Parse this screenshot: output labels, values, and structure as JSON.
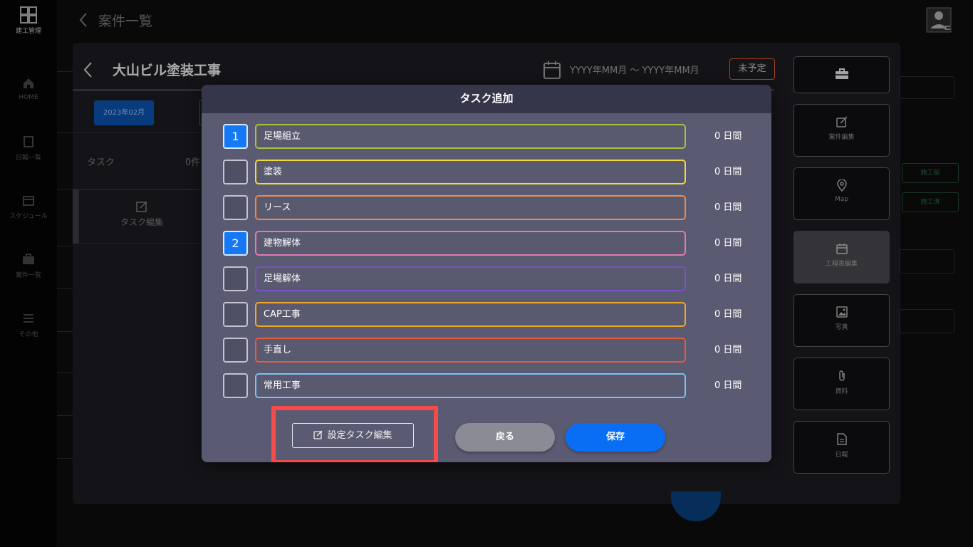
{
  "app": {
    "logo_text": "建工管理",
    "page_title": "案件一覧"
  },
  "nav": {
    "items": [
      {
        "label": "HOME",
        "icon": "home-icon"
      },
      {
        "label": "日報一覧",
        "icon": "document-icon"
      },
      {
        "label": "スケジュール",
        "icon": "calendar-icon"
      },
      {
        "label": "案件一覧",
        "icon": "briefcase-icon"
      },
      {
        "label": "その他",
        "icon": "menu-icon"
      }
    ]
  },
  "project": {
    "title": "大山ビル塗装工事",
    "date_range": "YYYY年MM月  〜  YYYY年MM月",
    "status": "未予定",
    "month": "2023年02月",
    "task_label": "タスク",
    "task_count": "0件",
    "task_edit_label": "タスク編集"
  },
  "side_buttons": [
    {
      "label": "",
      "icon": "briefcase-icon"
    },
    {
      "label": "案件編集",
      "icon": "edit-icon"
    },
    {
      "label": "Map",
      "icon": "map-pin-icon"
    },
    {
      "label": "工程表編集",
      "icon": "calendar-icon",
      "active": true
    },
    {
      "label": "写真",
      "icon": "image-icon"
    },
    {
      "label": "資料",
      "icon": "paperclip-icon"
    },
    {
      "label": "日報",
      "icon": "document-icon"
    }
  ],
  "right_fragments": {
    "before_work": "施工前",
    "after_work": "施工済"
  },
  "modal": {
    "title": "タスク追加",
    "tasks": [
      {
        "order": "1",
        "checked": true,
        "name": "足場組立",
        "days": "0 日間",
        "color": "#a7c33a"
      },
      {
        "order": "",
        "checked": false,
        "name": "塗装",
        "days": "0 日間",
        "color": "#f3d83b"
      },
      {
        "order": "",
        "checked": false,
        "name": "リース",
        "days": "0 日間",
        "color": "#f0894a"
      },
      {
        "order": "2",
        "checked": true,
        "name": "建物解体",
        "days": "0 日間",
        "color": "#e57ab3"
      },
      {
        "order": "",
        "checked": false,
        "name": "足場解体",
        "days": "0 日間",
        "color": "#7a52c7"
      },
      {
        "order": "",
        "checked": false,
        "name": "CAP工事",
        "days": "0 日間",
        "color": "#f0a92a"
      },
      {
        "order": "",
        "checked": false,
        "name": "手直し",
        "days": "0 日間",
        "color": "#e55b3c"
      },
      {
        "order": "",
        "checked": false,
        "name": "常用工事",
        "days": "0 日間",
        "color": "#7cc1f2"
      }
    ],
    "edit_tasks_label": "設定タスク編集",
    "back_label": "戻る",
    "save_label": "保存",
    "colors": {
      "accent": "#0a6ef5",
      "highlight": "#f54b4b",
      "checked": "#1579f5"
    }
  }
}
